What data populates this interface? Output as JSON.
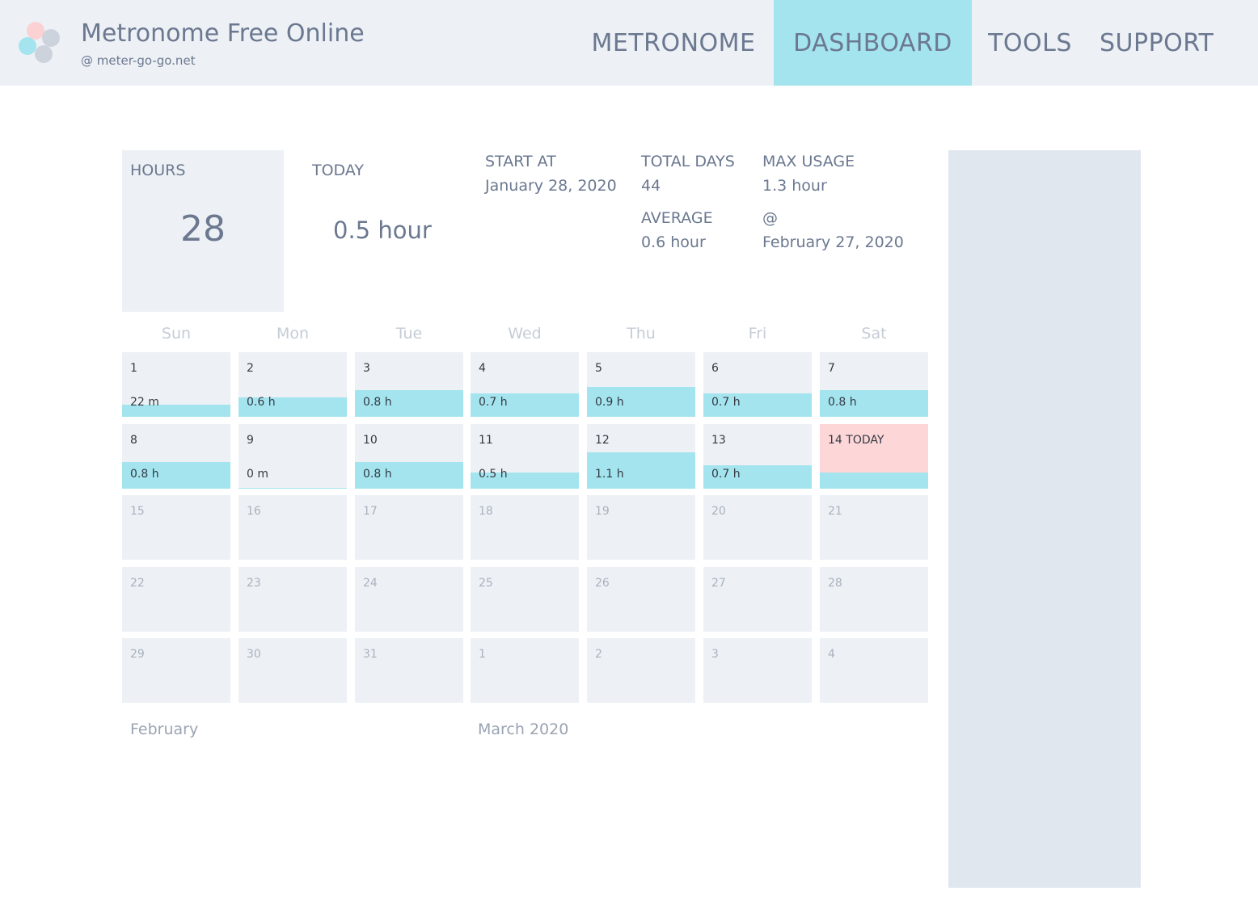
{
  "header": {
    "title": "Metronome Free Online",
    "subtitle": "@ meter-go-go.net",
    "nav": [
      {
        "label": "METRONOME",
        "active": false
      },
      {
        "label": "DASHBOARD",
        "active": true
      },
      {
        "label": "TOOLS",
        "active": false
      },
      {
        "label": "SUPPORT",
        "active": false
      }
    ]
  },
  "stats": {
    "hours_label": "HOURS",
    "hours_value": "28",
    "today_label": "TODAY",
    "today_value": "0.5 hour",
    "start_label": "START AT",
    "start_value": "January 28, 2020",
    "total_days_label": "TOTAL DAYS",
    "total_days_value": "44",
    "average_label": "AVERAGE",
    "average_value": "0.6 hour",
    "max_usage_label": "MAX USAGE",
    "max_usage_value": "1.3 hour",
    "max_usage_at_label": "@",
    "max_usage_at_value": "February 27, 2020"
  },
  "calendar": {
    "weekdays": [
      "Sun",
      "Mon",
      "Tue",
      "Wed",
      "Thu",
      "Fri",
      "Sat"
    ],
    "weeks": [
      [
        {
          "day": "1",
          "usage": "22 m",
          "level": 0.28
        },
        {
          "day": "2",
          "usage": "0.6 h",
          "level": 0.46
        },
        {
          "day": "3",
          "usage": "0.8 h",
          "level": 0.62
        },
        {
          "day": "4",
          "usage": "0.7 h",
          "level": 0.54
        },
        {
          "day": "5",
          "usage": "0.9 h",
          "level": 0.69
        },
        {
          "day": "6",
          "usage": "0.7 h",
          "level": 0.54
        },
        {
          "day": "7",
          "usage": "0.8 h",
          "level": 0.62
        }
      ],
      [
        {
          "day": "8",
          "usage": "0.8 h",
          "level": 0.62
        },
        {
          "day": "9",
          "usage": "0 m",
          "level": 0.0
        },
        {
          "day": "10",
          "usage": "0.8 h",
          "level": 0.62
        },
        {
          "day": "11",
          "usage": "0.5 h",
          "level": 0.38
        },
        {
          "day": "12",
          "usage": "1.1 h",
          "level": 0.85
        },
        {
          "day": "13",
          "usage": "0.7 h",
          "level": 0.54
        },
        {
          "day": "14 TODAY",
          "usage": "",
          "level": 0.38,
          "today": true
        }
      ],
      [
        {
          "day": "15",
          "future": true
        },
        {
          "day": "16",
          "future": true
        },
        {
          "day": "17",
          "future": true
        },
        {
          "day": "18",
          "future": true
        },
        {
          "day": "19",
          "future": true
        },
        {
          "day": "20",
          "future": true
        },
        {
          "day": "21",
          "future": true
        }
      ],
      [
        {
          "day": "22",
          "future": true
        },
        {
          "day": "23",
          "future": true
        },
        {
          "day": "24",
          "future": true
        },
        {
          "day": "25",
          "future": true
        },
        {
          "day": "26",
          "future": true
        },
        {
          "day": "27",
          "future": true
        },
        {
          "day": "28",
          "future": true
        }
      ],
      [
        {
          "day": "29",
          "future": true
        },
        {
          "day": "30",
          "future": true
        },
        {
          "day": "31",
          "future": true
        },
        {
          "day": "1",
          "future": true
        },
        {
          "day": "2",
          "future": true
        },
        {
          "day": "3",
          "future": true
        },
        {
          "day": "4",
          "future": true
        }
      ]
    ],
    "prev_month_label": "February",
    "current_month_label": "March 2020"
  },
  "colors": {
    "accent": "#a4e4ee",
    "today": "#fdd6d7",
    "cell": "#edf1f5",
    "text": "#6b7890"
  }
}
